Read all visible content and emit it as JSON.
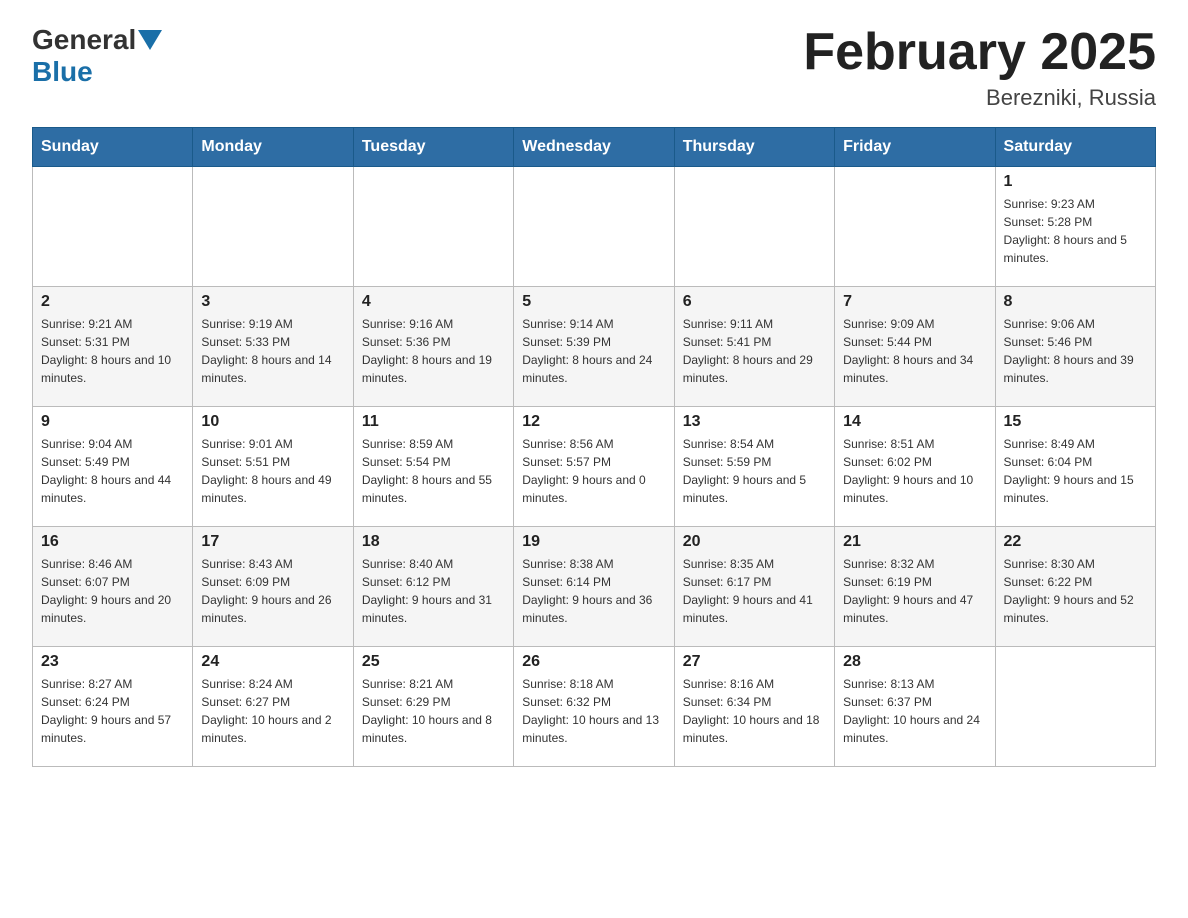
{
  "header": {
    "logo": {
      "general": "General",
      "blue": "Blue"
    },
    "title": "February 2025",
    "location": "Berezniki, Russia"
  },
  "days_of_week": [
    "Sunday",
    "Monday",
    "Tuesday",
    "Wednesday",
    "Thursday",
    "Friday",
    "Saturday"
  ],
  "weeks": [
    {
      "days": [
        {
          "number": "",
          "info": ""
        },
        {
          "number": "",
          "info": ""
        },
        {
          "number": "",
          "info": ""
        },
        {
          "number": "",
          "info": ""
        },
        {
          "number": "",
          "info": ""
        },
        {
          "number": "",
          "info": ""
        },
        {
          "number": "1",
          "info": "Sunrise: 9:23 AM\nSunset: 5:28 PM\nDaylight: 8 hours and 5 minutes."
        }
      ]
    },
    {
      "days": [
        {
          "number": "2",
          "info": "Sunrise: 9:21 AM\nSunset: 5:31 PM\nDaylight: 8 hours and 10 minutes."
        },
        {
          "number": "3",
          "info": "Sunrise: 9:19 AM\nSunset: 5:33 PM\nDaylight: 8 hours and 14 minutes."
        },
        {
          "number": "4",
          "info": "Sunrise: 9:16 AM\nSunset: 5:36 PM\nDaylight: 8 hours and 19 minutes."
        },
        {
          "number": "5",
          "info": "Sunrise: 9:14 AM\nSunset: 5:39 PM\nDaylight: 8 hours and 24 minutes."
        },
        {
          "number": "6",
          "info": "Sunrise: 9:11 AM\nSunset: 5:41 PM\nDaylight: 8 hours and 29 minutes."
        },
        {
          "number": "7",
          "info": "Sunrise: 9:09 AM\nSunset: 5:44 PM\nDaylight: 8 hours and 34 minutes."
        },
        {
          "number": "8",
          "info": "Sunrise: 9:06 AM\nSunset: 5:46 PM\nDaylight: 8 hours and 39 minutes."
        }
      ]
    },
    {
      "days": [
        {
          "number": "9",
          "info": "Sunrise: 9:04 AM\nSunset: 5:49 PM\nDaylight: 8 hours and 44 minutes."
        },
        {
          "number": "10",
          "info": "Sunrise: 9:01 AM\nSunset: 5:51 PM\nDaylight: 8 hours and 49 minutes."
        },
        {
          "number": "11",
          "info": "Sunrise: 8:59 AM\nSunset: 5:54 PM\nDaylight: 8 hours and 55 minutes."
        },
        {
          "number": "12",
          "info": "Sunrise: 8:56 AM\nSunset: 5:57 PM\nDaylight: 9 hours and 0 minutes."
        },
        {
          "number": "13",
          "info": "Sunrise: 8:54 AM\nSunset: 5:59 PM\nDaylight: 9 hours and 5 minutes."
        },
        {
          "number": "14",
          "info": "Sunrise: 8:51 AM\nSunset: 6:02 PM\nDaylight: 9 hours and 10 minutes."
        },
        {
          "number": "15",
          "info": "Sunrise: 8:49 AM\nSunset: 6:04 PM\nDaylight: 9 hours and 15 minutes."
        }
      ]
    },
    {
      "days": [
        {
          "number": "16",
          "info": "Sunrise: 8:46 AM\nSunset: 6:07 PM\nDaylight: 9 hours and 20 minutes."
        },
        {
          "number": "17",
          "info": "Sunrise: 8:43 AM\nSunset: 6:09 PM\nDaylight: 9 hours and 26 minutes."
        },
        {
          "number": "18",
          "info": "Sunrise: 8:40 AM\nSunset: 6:12 PM\nDaylight: 9 hours and 31 minutes."
        },
        {
          "number": "19",
          "info": "Sunrise: 8:38 AM\nSunset: 6:14 PM\nDaylight: 9 hours and 36 minutes."
        },
        {
          "number": "20",
          "info": "Sunrise: 8:35 AM\nSunset: 6:17 PM\nDaylight: 9 hours and 41 minutes."
        },
        {
          "number": "21",
          "info": "Sunrise: 8:32 AM\nSunset: 6:19 PM\nDaylight: 9 hours and 47 minutes."
        },
        {
          "number": "22",
          "info": "Sunrise: 8:30 AM\nSunset: 6:22 PM\nDaylight: 9 hours and 52 minutes."
        }
      ]
    },
    {
      "days": [
        {
          "number": "23",
          "info": "Sunrise: 8:27 AM\nSunset: 6:24 PM\nDaylight: 9 hours and 57 minutes."
        },
        {
          "number": "24",
          "info": "Sunrise: 8:24 AM\nSunset: 6:27 PM\nDaylight: 10 hours and 2 minutes."
        },
        {
          "number": "25",
          "info": "Sunrise: 8:21 AM\nSunset: 6:29 PM\nDaylight: 10 hours and 8 minutes."
        },
        {
          "number": "26",
          "info": "Sunrise: 8:18 AM\nSunset: 6:32 PM\nDaylight: 10 hours and 13 minutes."
        },
        {
          "number": "27",
          "info": "Sunrise: 8:16 AM\nSunset: 6:34 PM\nDaylight: 10 hours and 18 minutes."
        },
        {
          "number": "28",
          "info": "Sunrise: 8:13 AM\nSunset: 6:37 PM\nDaylight: 10 hours and 24 minutes."
        },
        {
          "number": "",
          "info": ""
        }
      ]
    }
  ]
}
